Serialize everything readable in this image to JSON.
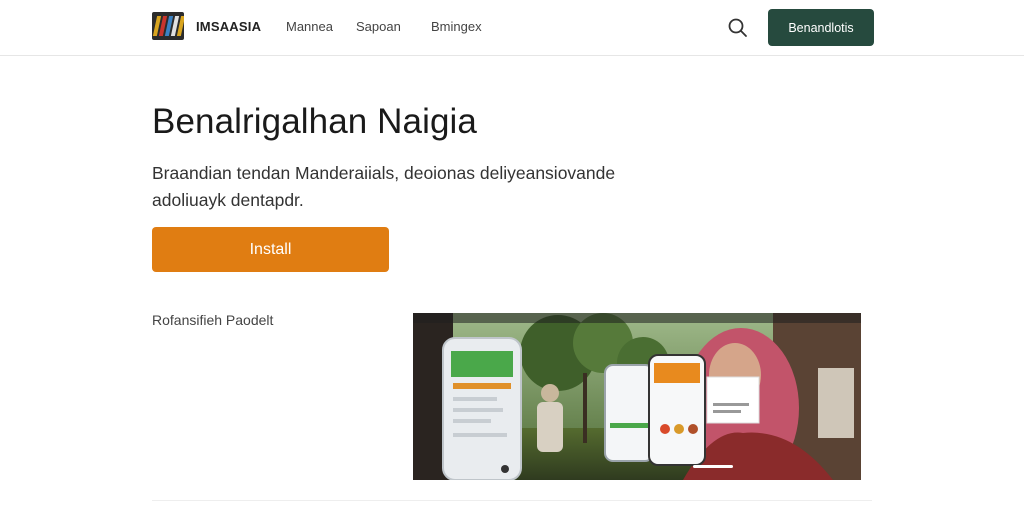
{
  "header": {
    "brand": "IMSAASIA",
    "nav": [
      "Mannea",
      "Sapoan",
      "Bmingex"
    ],
    "cta_label": "Benandlotis"
  },
  "hero": {
    "title": "Benalrigalhan Naigia",
    "description": "Braandian tendan Manderaiials, deoionas deliyeansiovande adoliuayk dentapdr.",
    "install_label": "Install"
  },
  "section": {
    "label": "Rofansifieh Paodelt"
  },
  "icons": {
    "search": "search-icon",
    "logo": "brand-logo-icon"
  },
  "colors": {
    "cta_bg": "#264a3e",
    "install_bg": "#e07d12",
    "text": "#1a1a1a"
  }
}
